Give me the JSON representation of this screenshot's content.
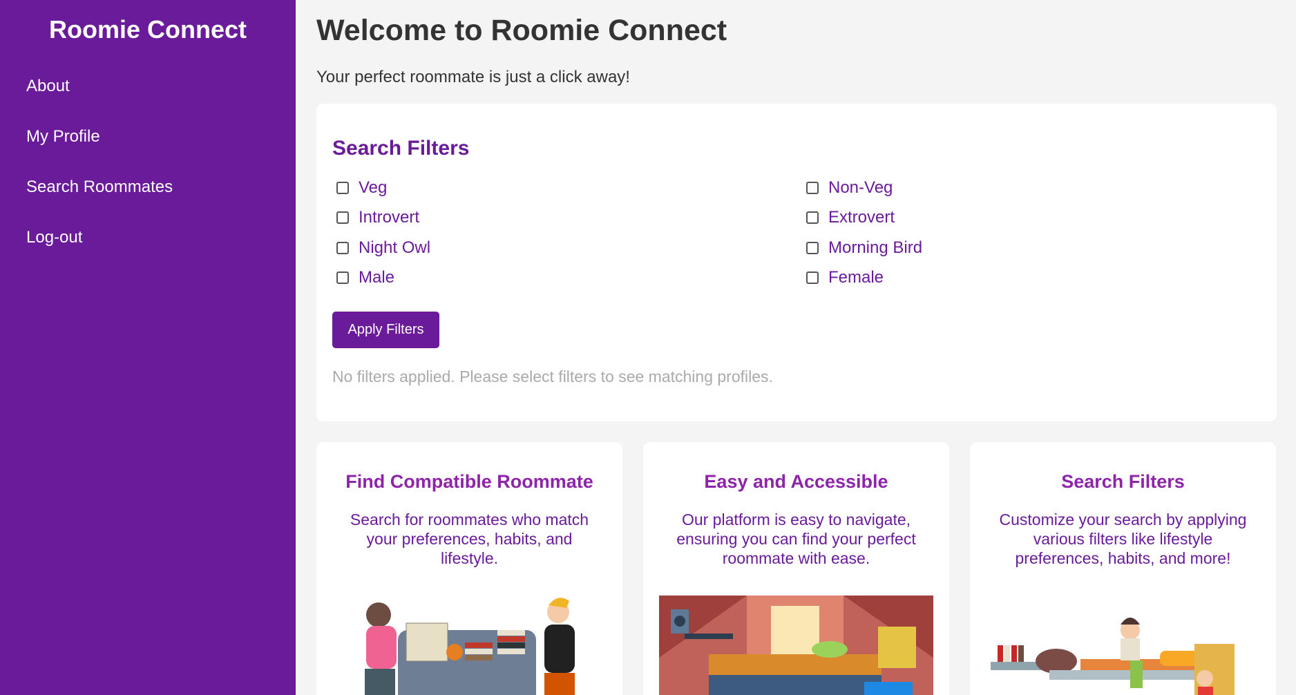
{
  "sidebar": {
    "brand": "Roomie Connect",
    "items": [
      {
        "label": "About"
      },
      {
        "label": "My Profile"
      },
      {
        "label": "Search Roommates"
      },
      {
        "label": "Log-out"
      }
    ]
  },
  "header": {
    "title": "Welcome to Roomie Connect",
    "subtitle": "Your perfect roommate is just a click away!"
  },
  "filters": {
    "title": "Search Filters",
    "options": [
      {
        "label": "Veg",
        "checked": false
      },
      {
        "label": "Non-Veg",
        "checked": false
      },
      {
        "label": "Introvert",
        "checked": false
      },
      {
        "label": "Extrovert",
        "checked": false
      },
      {
        "label": "Night Owl",
        "checked": false
      },
      {
        "label": "Morning Bird",
        "checked": false
      },
      {
        "label": "Male",
        "checked": false
      },
      {
        "label": "Female",
        "checked": false
      }
    ],
    "apply_label": "Apply Filters",
    "status": "No filters applied. Please select filters to see matching profiles."
  },
  "cards": [
    {
      "title": "Find Compatible Roommate",
      "text": "Search for roommates who match your preferences, habits, and lifestyle.",
      "illustration": "movers-carrying-couch"
    },
    {
      "title": "Easy and Accessible",
      "text": "Our platform is easy to navigate, ensuring you can find your perfect roommate with ease.",
      "illustration": "attic-bedroom"
    },
    {
      "title": "Search Filters",
      "text": "Customize your search by applying various filters like lifestyle preferences, habits, and more!",
      "illustration": "dorm-room-student"
    }
  ],
  "colors": {
    "sidebar_bg": "#6a1b9a",
    "accent": "#6a1b9a",
    "card_title": "#8e24aa",
    "page_bg": "#f4f4f4"
  }
}
